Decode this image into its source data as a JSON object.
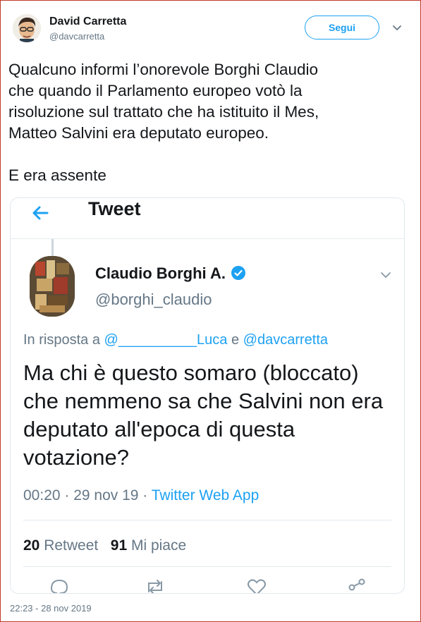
{
  "author": {
    "name": "David Carretta",
    "handle": "@davcarretta"
  },
  "follow_label": "Segui",
  "tweet_text": "Qualcuno informi l’onorevole Borghi Claudio\nche quando il Parlamento europeo votò la\nrisoluzione sul trattato che ha istituito il Mes,\nMatteo Salvini era deputato europeo.\n\nE era assente",
  "embed": {
    "header_title": "Tweet",
    "author_name": "Claudio Borghi A.",
    "author_handle": "@borghi_claudio",
    "reply_prefix": "In risposta a ",
    "reply_mention_1": "@__________Luca",
    "reply_and": " e ",
    "reply_mention_2": "@davcarretta",
    "text": "Ma chi è questo somaro (bloccato) che nemmeno sa che Salvini non era deputato all'epoca di questa votazione?",
    "meta_time": "00:20 · 29 nov 19 · ",
    "meta_app": "Twitter Web App",
    "retweet_count": "20",
    "retweet_label": "Retweet",
    "like_count": "91",
    "like_label": "Mi piace"
  },
  "timestamp": "22:23 - 28 nov 2019",
  "colors": {
    "accent": "#1da1f2",
    "text": "#14171a",
    "muted": "#657786",
    "frame": "#c0392b"
  },
  "icons": [
    "back-arrow-icon",
    "verified-badge-icon",
    "chevron-down-icon",
    "reply-icon",
    "retweet-icon",
    "like-icon",
    "share-icon"
  ]
}
